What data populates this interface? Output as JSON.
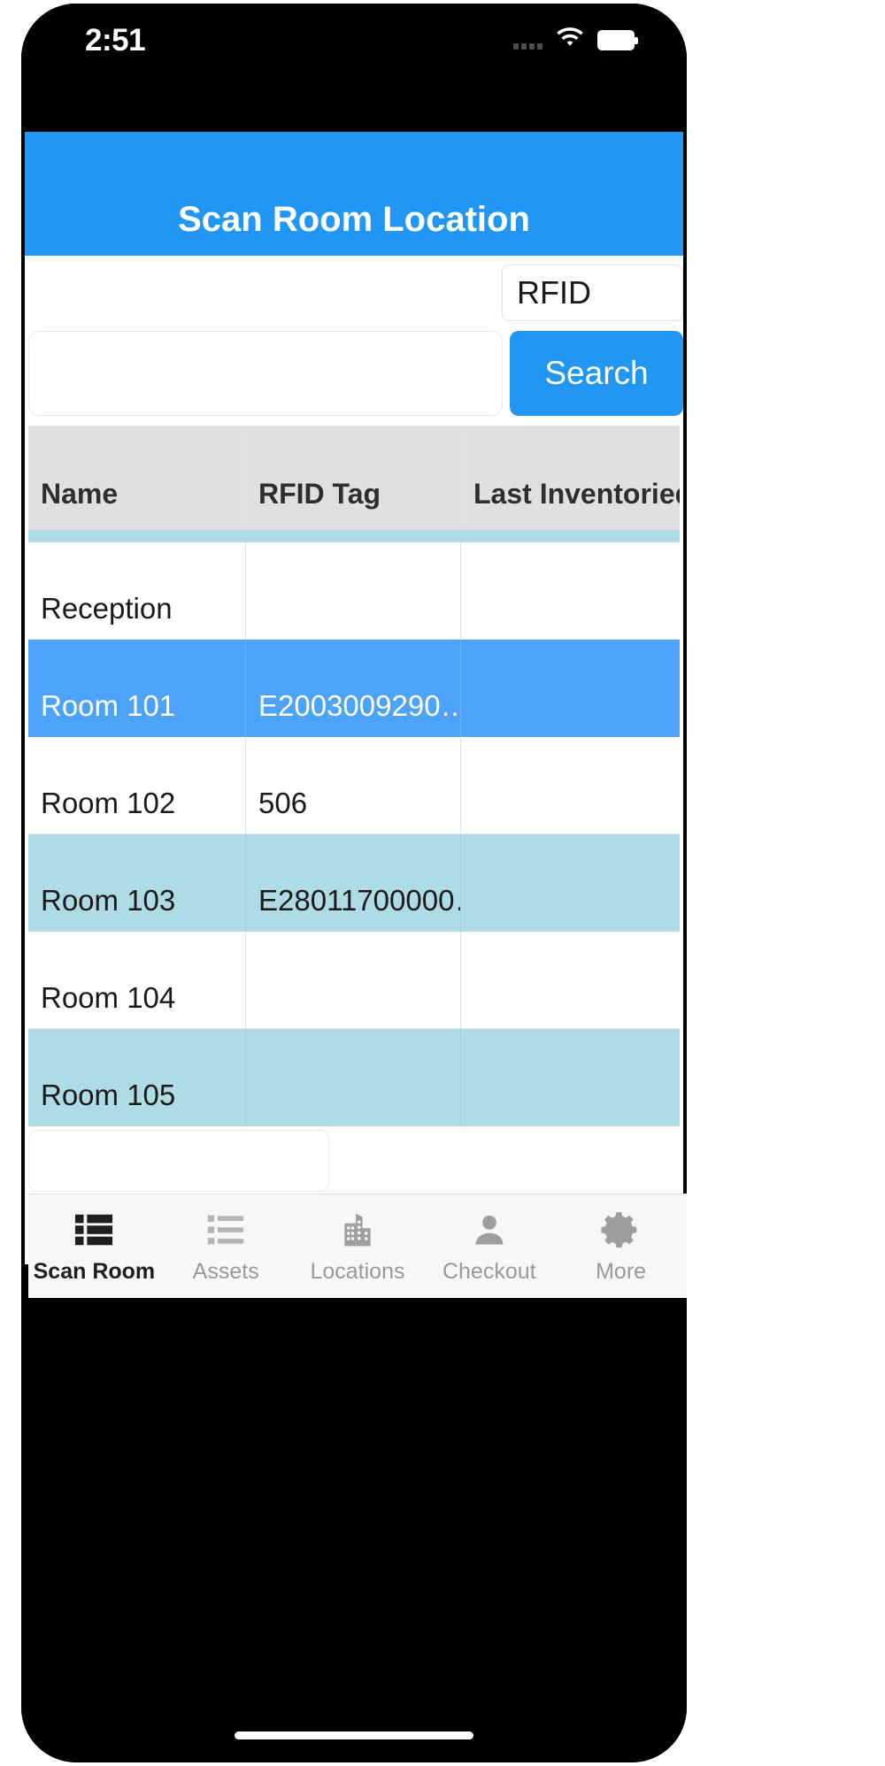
{
  "status_bar": {
    "time": "2:51",
    "signal_icon": "signal-dots-icon",
    "wifi_icon": "wifi-icon",
    "battery_icon": "battery-full-icon"
  },
  "header": {
    "title": "Scan Room Location",
    "background_color": "#2196f3",
    "title_color": "#ffffff"
  },
  "search": {
    "rfid_select_value": "RFID",
    "input_value": "",
    "input_placeholder": "",
    "search_button_label": "Search",
    "search_button_color": "#2196f3"
  },
  "table": {
    "columns": [
      "Name",
      "RFID Tag",
      "Last Inventoried"
    ],
    "header_background": "#e0e0e0",
    "separator_color": "#aedbe4",
    "selected_row_color": "#4da3f7",
    "alternate_row_color": "#aedbe4",
    "rows": [
      {
        "name": "Reception",
        "rfid_tag": "",
        "last_inventoried": "",
        "style": "white"
      },
      {
        "name": "Room 101",
        "rfid_tag": "E2003009290…",
        "last_inventoried": "",
        "style": "blue"
      },
      {
        "name": "Room 102",
        "rfid_tag": "506",
        "last_inventoried": "",
        "style": "white"
      },
      {
        "name": "Room 103",
        "rfid_tag": "E28011700000…",
        "last_inventoried": "",
        "style": "teal"
      },
      {
        "name": "Room 104",
        "rfid_tag": "",
        "last_inventoried": "",
        "style": "white"
      },
      {
        "name": "Room 105",
        "rfid_tag": "",
        "last_inventoried": "",
        "style": "teal"
      }
    ]
  },
  "bottom_field": {
    "value": "",
    "placeholder": ""
  },
  "tab_bar": {
    "items": [
      {
        "label": "Scan Room",
        "icon": "list-detail-icon",
        "active": true
      },
      {
        "label": "Assets",
        "icon": "list-icon",
        "active": false
      },
      {
        "label": "Locations",
        "icon": "building-icon",
        "active": false
      },
      {
        "label": "Checkout",
        "icon": "person-icon",
        "active": false
      },
      {
        "label": "More",
        "icon": "gear-icon",
        "active": false
      }
    ]
  }
}
